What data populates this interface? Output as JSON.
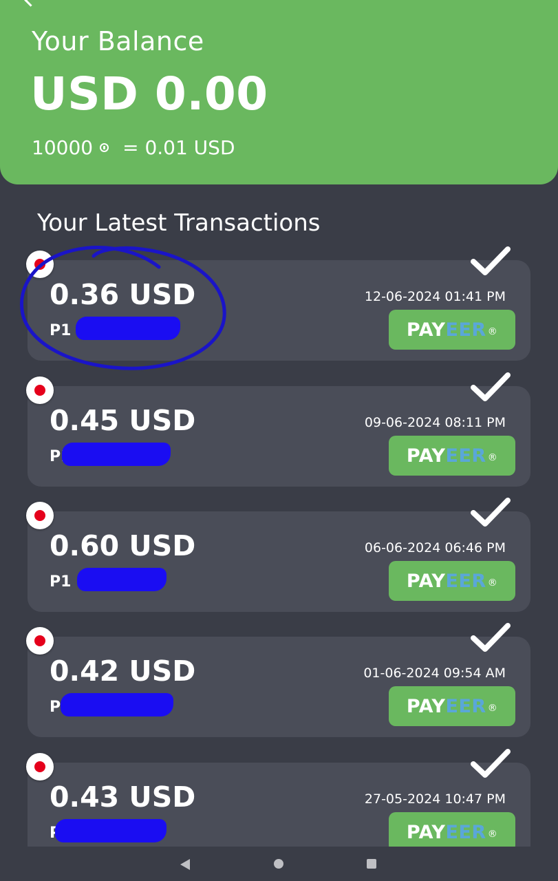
{
  "balance": {
    "label": "Your Balance",
    "amount": "USD 0.00",
    "rate_points": "10000",
    "rate_value": "= 0.01 USD"
  },
  "section_title": "Your Latest Transactions",
  "transactions": [
    {
      "amount": "0.36 USD",
      "account_prefix": "P1",
      "date": "12-06-2024 01:41 PM",
      "method": {
        "pay": "PAY",
        "eer": "EER",
        "reg": "®"
      },
      "status": "check-icon"
    },
    {
      "amount": "0.45 USD",
      "account_prefix": "P1",
      "date": "09-06-2024 08:11 PM",
      "method": {
        "pay": "PAY",
        "eer": "EER",
        "reg": "®"
      },
      "status": "check-icon"
    },
    {
      "amount": "0.60 USD",
      "account_prefix": "P1",
      "date": "06-06-2024 06:46 PM",
      "method": {
        "pay": "PAY",
        "eer": "EER",
        "reg": "®"
      },
      "status": "check-icon"
    },
    {
      "amount": "0.42 USD",
      "account_prefix": "P1",
      "date": "01-06-2024 09:54 AM",
      "method": {
        "pay": "PAY",
        "eer": "EER",
        "reg": "®"
      },
      "status": "check-icon"
    },
    {
      "amount": "0.43 USD",
      "account_prefix": "P1",
      "date": "27-05-2024 10:47 PM",
      "method": {
        "pay": "PAY",
        "eer": "EER",
        "reg": "®"
      },
      "status": "check-icon"
    }
  ],
  "colors": {
    "header_green": "#6ab85f",
    "background": "#3a3d47",
    "card": "#4a4d58",
    "payeer_blue": "#5aa7d8",
    "indicator_red": "#e5001b",
    "redaction_blue": "#1a0df2",
    "annotation_blue": "#1a14c8"
  },
  "icons": {
    "coin": "coin-icon",
    "check": "check-icon",
    "indicator": "red-dot-icon",
    "nav_back": "nav-back-icon",
    "nav_home": "nav-home-icon",
    "nav_recents": "nav-recents-icon"
  }
}
